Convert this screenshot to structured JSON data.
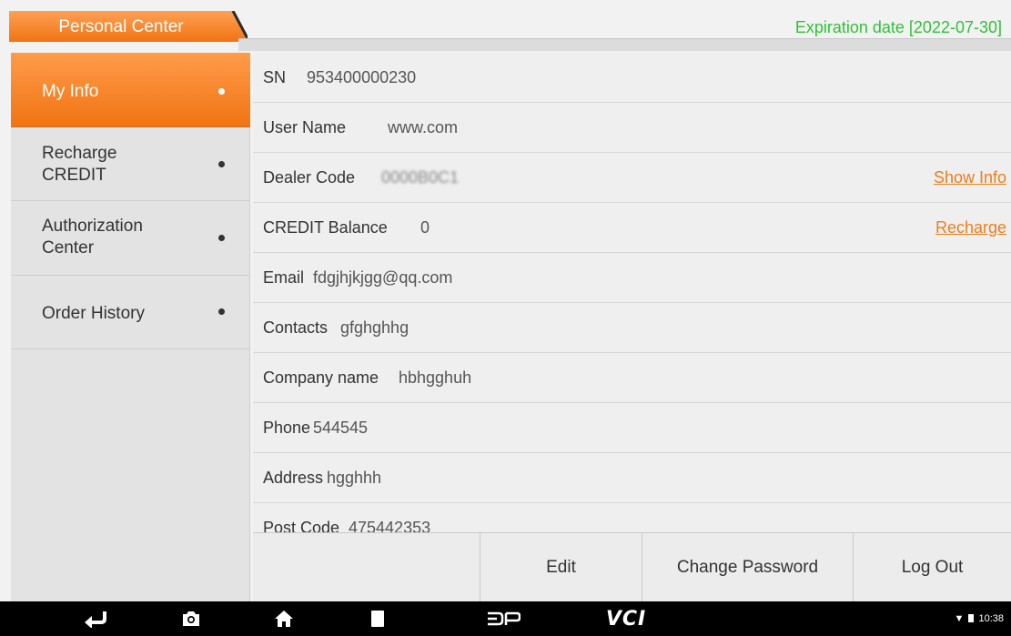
{
  "header": {
    "title": "Personal Center",
    "expiration": "Expiration date [2022-07-30]"
  },
  "sidebar": {
    "items": [
      {
        "label": "My Info",
        "active": true
      },
      {
        "label": "Recharge\nCREDIT",
        "active": false
      },
      {
        "label": "Authorization\nCenter",
        "active": false
      },
      {
        "label": "Order History",
        "active": false
      }
    ]
  },
  "info": {
    "rows": [
      {
        "label": "SN",
        "value": "953400000230"
      },
      {
        "label": "User Name",
        "value": "www.com"
      },
      {
        "label": "Dealer Code",
        "value": "0000B0C1",
        "link": "Show Info"
      },
      {
        "label": "CREDIT Balance",
        "value": "0",
        "link": "Recharge"
      },
      {
        "label": "Email",
        "value": "fdgjhjkjgg@qq.com"
      },
      {
        "label": "Contacts",
        "value": "gfghghhg"
      },
      {
        "label": "Company name",
        "value": "hbhgghuh"
      },
      {
        "label": "Phone",
        "value": "544545"
      },
      {
        "label": "Address",
        "value": "hgghhh"
      },
      {
        "label": "Post Code",
        "value": "475442353"
      }
    ]
  },
  "buttons": {
    "edit": "Edit",
    "change_password": "Change Password",
    "log_out": "Log Out"
  },
  "navbar": {
    "logo": "VCI",
    "time": "10:38"
  },
  "colors": {
    "accent": "#f07412",
    "expiration": "#2fc236",
    "link": "#f07c1a"
  }
}
